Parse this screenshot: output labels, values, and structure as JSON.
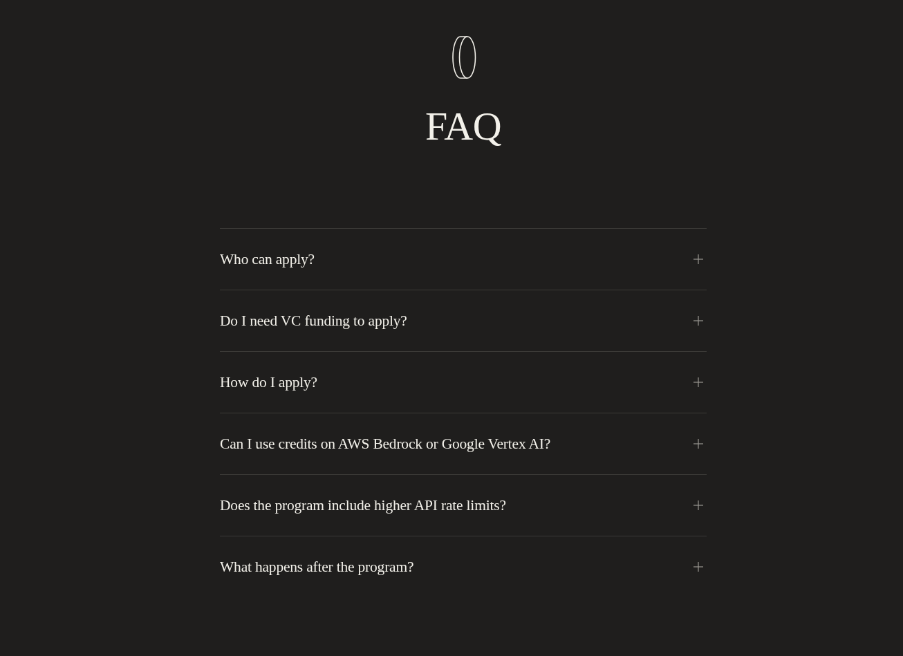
{
  "header": {
    "title": "FAQ"
  },
  "faq": [
    {
      "question": "Who can apply?",
      "expanded": false
    },
    {
      "question": "Do I need VC funding to apply?",
      "expanded": false
    },
    {
      "question": "How do I apply?",
      "expanded": false
    },
    {
      "question": "Can I use credits on AWS Bedrock or Google Vertex AI?",
      "expanded": false
    },
    {
      "question": "Does the program include higher API rate limits?",
      "expanded": false
    },
    {
      "question": "What happens after the program?",
      "expanded": false
    }
  ]
}
